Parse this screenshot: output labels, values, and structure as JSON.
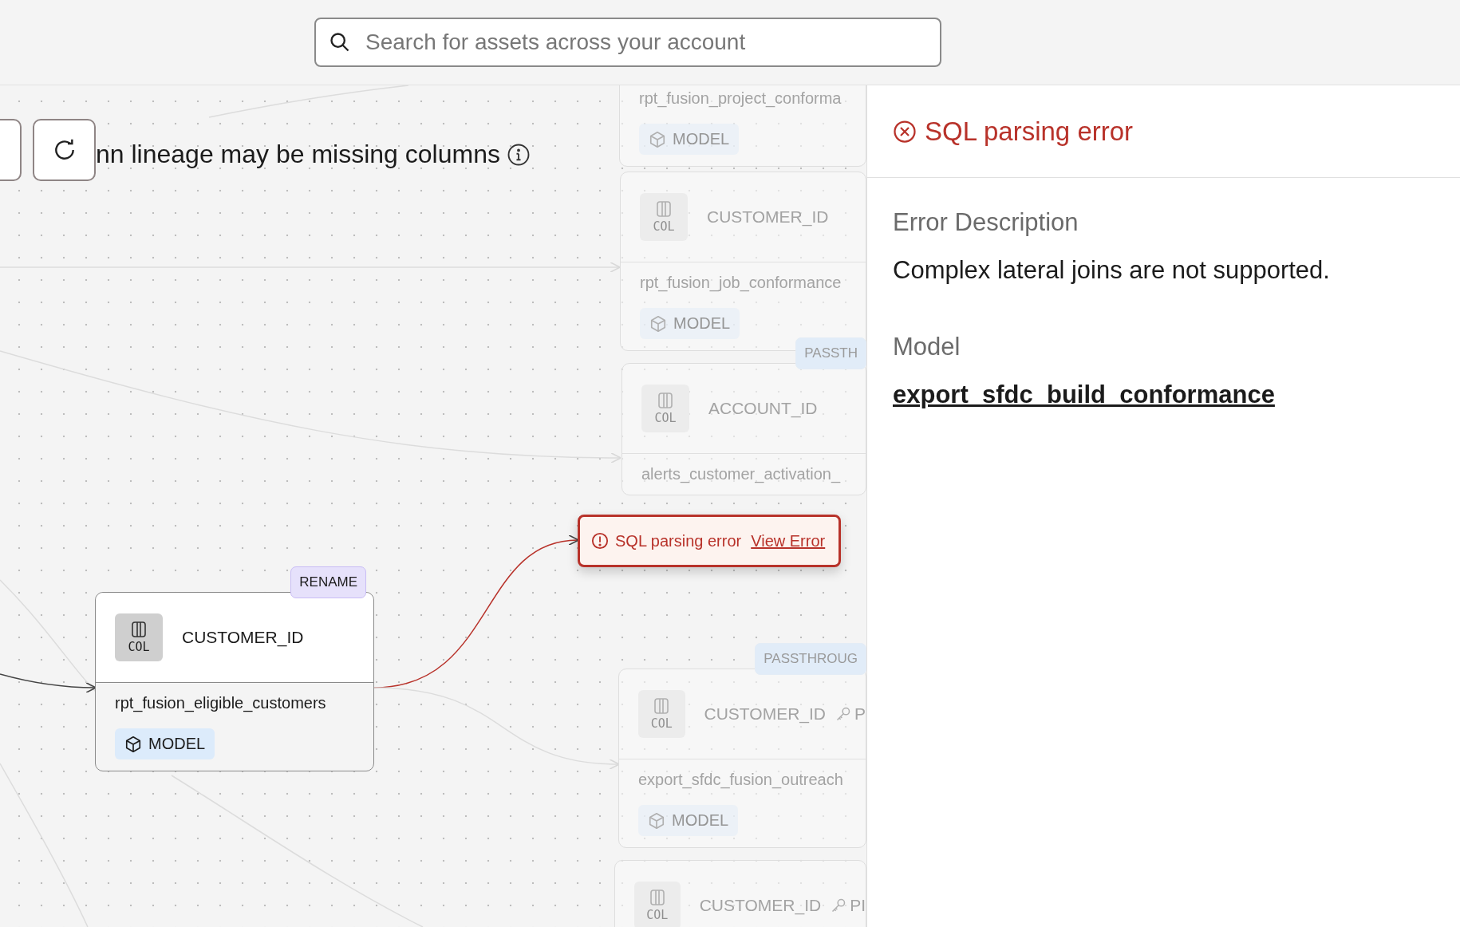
{
  "search": {
    "placeholder": "Search for assets across your account"
  },
  "canvas": {
    "notice": {
      "text": "nn lineage may be missing columns"
    },
    "nodes": [
      {
        "dimmed": true,
        "model": "rpt_fusion_project_conforma",
        "model_type": "MODEL"
      },
      {
        "dimmed": true,
        "column": "CUSTOMER_ID",
        "col_label": "COL",
        "model": "rpt_fusion_job_conformance",
        "model_type": "MODEL"
      },
      {
        "dimmed": true,
        "tag": {
          "text": "PASSTH",
          "color": "#e1ecf8"
        },
        "column": "ACCOUNT_ID",
        "col_label": "COL",
        "model": "alerts_customer_activation_"
      },
      {
        "dimmed": true,
        "tag": {
          "text": "PASSTHROUG",
          "color": "#e1ecf8"
        },
        "column": "CUSTOMER_ID",
        "key": "P",
        "col_label": "COL",
        "model": "export_sfdc_fusion_outreach",
        "model_type": "MODEL"
      },
      {
        "dimmed": true,
        "column": "CUSTOMER_ID",
        "key": "PI",
        "col_label": "COL"
      },
      {
        "dimmed": false,
        "tag": {
          "text": "RENAME",
          "color": "#e6e1fb"
        },
        "column": "CUSTOMER_ID",
        "col_label": "COL",
        "model": "rpt_fusion_eligible_customers",
        "model_type": "MODEL"
      }
    ],
    "error_popup": {
      "message": "SQL parsing error",
      "link": "View Error"
    }
  },
  "panel": {
    "title": "SQL parsing error",
    "sections": [
      {
        "kind": "text",
        "heading": "Error Description",
        "body": "Complex lateral joins are not supported."
      },
      {
        "kind": "link",
        "heading": "Model",
        "body": "export_sfdc_build_conformance"
      }
    ]
  }
}
